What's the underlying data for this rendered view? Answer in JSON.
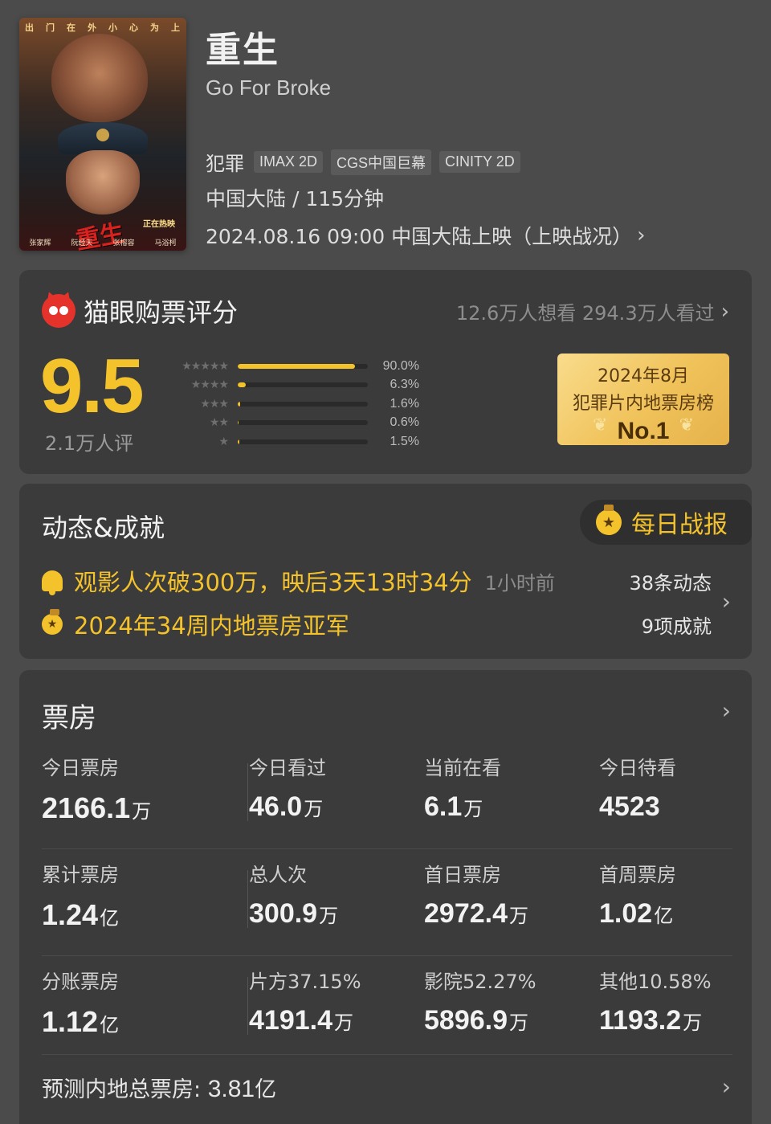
{
  "poster": {
    "tagline": [
      "出",
      "门",
      "在",
      "外",
      "小",
      "心",
      "为",
      "上"
    ],
    "title_art": "重生",
    "hot_label": "正在热映",
    "cast": [
      "张家辉",
      "阮经天",
      "张榕容",
      "马浴柯"
    ]
  },
  "movie": {
    "title": "重生",
    "english_title": "Go For Broke",
    "genre": "犯罪",
    "formats": [
      "IMAX 2D",
      "CGS中国巨幕",
      "CINITY 2D"
    ],
    "meta": "中国大陆 / 115分钟",
    "release": "2024.08.16 09:00 中国大陆上映（上映战况）"
  },
  "rating": {
    "brand": "猫眼购票评分",
    "wants": "12.6万人想看 294.3万人看过",
    "score": "9.5",
    "raters": "2.1万人评",
    "distribution": [
      {
        "stars": "★★★★★",
        "pct_label": "90.0%",
        "pct": 90.0
      },
      {
        "stars": "★★★★",
        "pct_label": "6.3%",
        "pct": 6.3
      },
      {
        "stars": "★★★",
        "pct_label": "1.6%",
        "pct": 1.6
      },
      {
        "stars": "★★",
        "pct_label": "0.6%",
        "pct": 0.6
      },
      {
        "stars": "★",
        "pct_label": "1.5%",
        "pct": 1.5
      }
    ],
    "award": {
      "line1": "2024年8月",
      "line2": "犯罪片内地票房榜",
      "line3": "No.1"
    }
  },
  "achievements": {
    "title": "动态&成就",
    "daily_label": "每日战报",
    "items": [
      {
        "text": "观影人次破300万，映后3天13时34分",
        "time": "1小时前",
        "icon": "bell-icon"
      },
      {
        "text": "2024年34周内地票房亚军",
        "icon": "medal-icon"
      }
    ],
    "count_dynamic": "38条动态",
    "count_achieve": "9项成就"
  },
  "boxoffice": {
    "title": "票房",
    "rows": [
      [
        {
          "label": "今日票房",
          "value": "2166.1",
          "unit": "万"
        },
        {
          "label": "今日看过",
          "value": "46.0",
          "unit": "万"
        },
        {
          "label": "当前在看",
          "value": "6.1",
          "unit": "万"
        },
        {
          "label": "今日待看",
          "value": "4523",
          "unit": ""
        }
      ],
      [
        {
          "label": "累计票房",
          "value": "1.24",
          "unit": "亿"
        },
        {
          "label": "总人次",
          "value": "300.9",
          "unit": "万"
        },
        {
          "label": "首日票房",
          "value": "2972.4",
          "unit": "万"
        },
        {
          "label": "首周票房",
          "value": "1.02",
          "unit": "亿"
        }
      ],
      [
        {
          "label": "分账票房",
          "value": "1.12",
          "unit": "亿"
        },
        {
          "label": "片方37.15%",
          "value": "4191.4",
          "unit": "万"
        },
        {
          "label": "影院52.27%",
          "value": "5896.9",
          "unit": "万"
        },
        {
          "label": "其他10.58%",
          "value": "1193.2",
          "unit": "万"
        }
      ]
    ],
    "forecast_label": "预测内地总票房:",
    "forecast_value": "3.81",
    "forecast_unit": "亿"
  },
  "colors": {
    "accent": "#f4c22b",
    "brand_red": "#e5322b",
    "background": "#4b4b4b",
    "card": "#3b3b3b"
  }
}
